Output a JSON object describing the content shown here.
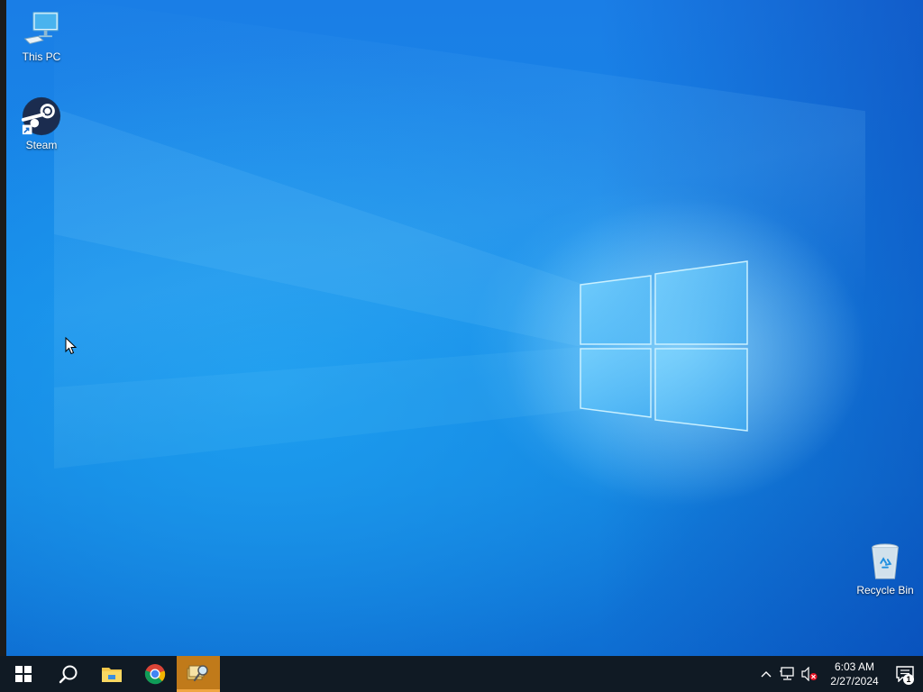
{
  "desktop": {
    "icons": [
      {
        "label": "This PC",
        "icon": "this-pc-icon"
      },
      {
        "label": "Steam",
        "icon": "steam-icon"
      },
      {
        "label": "Recycle Bin",
        "icon": "recycle-bin-icon"
      }
    ],
    "wallpaper": {
      "name": "windows-logo-wallpaper",
      "accent": "#1a86e8"
    }
  },
  "taskbar": {
    "background": "#101a24",
    "buttons": [
      {
        "icon": "windows-start-icon"
      },
      {
        "icon": "search-icon"
      },
      {
        "icon": "file-explorer-icon"
      },
      {
        "icon": "chrome-icon"
      },
      {
        "icon": "active-app-icon",
        "active": true
      }
    ],
    "tray": {
      "icons": [
        "chevron-up-icon",
        "network-icon",
        "volume-muted-icon"
      ],
      "time": "6:03 AM",
      "date": "2/27/2024",
      "notification_count": "1"
    }
  }
}
